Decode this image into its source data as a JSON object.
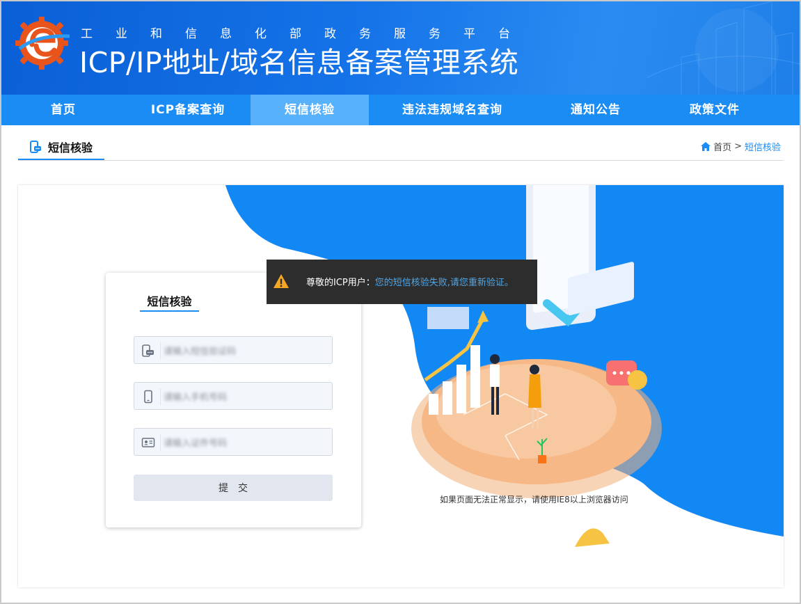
{
  "header": {
    "subtitle_chars": [
      "工",
      "业",
      "和",
      "信",
      "息",
      "化",
      "部",
      "政",
      "务",
      "服",
      "务",
      "平",
      "台"
    ],
    "title": "ICP/IP地址/域名信息备案管理系统"
  },
  "nav": {
    "items": [
      {
        "label": "首页",
        "active": false
      },
      {
        "label": "ICP备案查询",
        "active": false
      },
      {
        "label": "短信核验",
        "active": true
      },
      {
        "label": "违法违规域名查询",
        "active": false
      },
      {
        "label": "通知公告",
        "active": false
      },
      {
        "label": "政策文件",
        "active": false
      }
    ]
  },
  "section": {
    "title": "短信核验"
  },
  "breadcrumb": {
    "home": "首页",
    "separator": ">",
    "current": "短信核验"
  },
  "form": {
    "title": "短信核验",
    "fields": [
      {
        "icon": "sms-code-icon",
        "value": "请输入短信验证码"
      },
      {
        "icon": "mobile-phone-icon",
        "value": "请输入手机号码"
      },
      {
        "icon": "id-card-icon",
        "value": "请输入证件号码"
      }
    ],
    "submit_label": "提交"
  },
  "toast": {
    "prefix": "尊敬的ICP用户：",
    "message": "您的短信核验失败,请您重新验证。",
    "icon": "warning-icon"
  },
  "note": "如果页面无法正常显示，请使用IE8以上浏览器访问",
  "colors": {
    "brand_blue": "#1a8cf4",
    "nav_active": "#58b2fb",
    "header_dark": "#0a5fd6",
    "toast_bg": "#2d2d2d",
    "toast_highlight": "#4fa6e6",
    "warning": "#f5a623"
  }
}
